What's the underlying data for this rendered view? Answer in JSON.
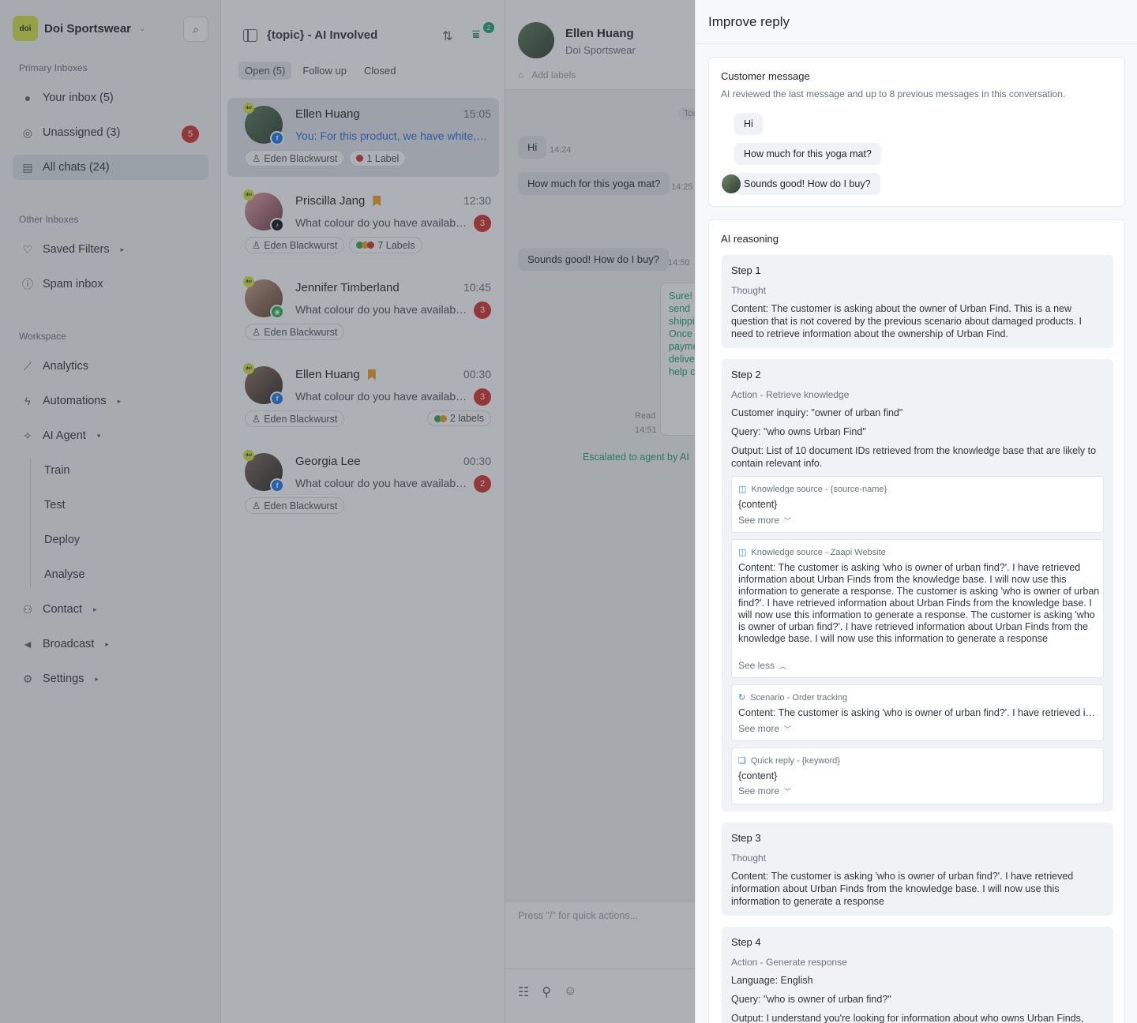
{
  "sidebar": {
    "brand_logo": "doi",
    "brand_name": "Doi Sportswear",
    "primary_label": "Primary Inboxes",
    "your_inbox": "Your inbox (5)",
    "unassigned": "Unassigned (3)",
    "unassigned_badge": "5",
    "all_chats": "All chats (24)",
    "other_label": "Other Inboxes",
    "saved_filters": "Saved Filters",
    "spam_inbox": "Spam inbox",
    "workspace_label": "Workspace",
    "analytics": "Analytics",
    "automations": "Automations",
    "ai_agent": "AI Agent",
    "ai_sub": [
      "Train",
      "Test",
      "Deploy",
      "Analyse"
    ],
    "contact": "Contact",
    "broadcast": "Broadcast",
    "settings": "Settings"
  },
  "conv_list": {
    "title": "{topic} - AI Involved",
    "filter_count": "2",
    "tabs": [
      "Open (5)",
      "Follow up",
      "Closed"
    ],
    "items": [
      {
        "name": "Ellen Huang",
        "time": "15:05",
        "preview": "You: For this product, we have white, black and grey",
        "agent": "Eden Blackwurst",
        "label": "1 Label",
        "channel": "f"
      },
      {
        "name": "Priscilla Jang",
        "time": "12:30",
        "preview": "What colour do you have available?",
        "badge": "3",
        "agent": "Eden Blackwurst",
        "label": "7 Labels",
        "channel": "♪"
      },
      {
        "name": "Jennifer Timberland",
        "time": "10:45",
        "preview": "What colour do you have available?",
        "badge": "3",
        "agent": "Eden Blackwurst",
        "channel": "◉"
      },
      {
        "name": "Ellen Huang",
        "time": "00:30",
        "preview": "What colour do you have available?",
        "badge": "3",
        "agent": "Eden Blackwurst",
        "label": "2 labels",
        "channel": "f"
      },
      {
        "name": "Georgia Lee",
        "time": "00:30",
        "preview": "What colour do you have available?",
        "badge": "2",
        "agent": "Eden Blackwurst",
        "channel": "f"
      }
    ]
  },
  "chat": {
    "name": "Ellen Huang",
    "sub": "Doi Sportswear",
    "add_labels": "Add labels",
    "today": "Tod",
    "messages": [
      {
        "text": "Hi",
        "time": "14:24"
      },
      {
        "text": "How much for this yoga mat?",
        "time": "14:25"
      },
      {
        "text": "Sounds good! How do I buy?",
        "time": "14:50"
      }
    ],
    "agent_reply": "Sure! send shippi Once payme delive help c",
    "read": "Read",
    "read_time": "14:51",
    "escalated": "Escalated to agent by AI",
    "composer_placeholder": "Press \"/\" for quick actions..."
  },
  "drawer": {
    "title": "Improve reply",
    "customer_message": {
      "title": "Customer message",
      "subtitle": "AI reviewed the last message and up to 8 previous messages in this conversation.",
      "messages": [
        "Hi",
        "How much for this yoga mat?",
        "Sounds good! How do I buy?"
      ]
    },
    "reasoning_title": "AI reasoning",
    "steps": [
      {
        "title": "Step 1",
        "kind": "Thought",
        "content": "Content: The customer is asking about the owner of Urban Find. This is a new question that is not covered by the previous scenario about damaged products. I need to retrieve information about the ownership of Urban Find."
      },
      {
        "title": "Step 2",
        "kind": "Action - Retrieve knowledge",
        "inquiry": "Customer inquiry: \"owner of urban find\"",
        "query": "Query: \"who owns Urban Find\"",
        "output": "Output: List of 10 document IDs retrieved from the knowledge base that are likely to contain relevant info.",
        "sources": [
          {
            "head": "Knowledge source - {source-name}",
            "body": "{content}",
            "toggle": "See more"
          },
          {
            "head": "Knowledge source - Zaapi Website",
            "body": "Content: The customer is asking 'who is owner of urban find?'. I have retrieved information about Urban Finds from the knowledge base. I will now use this information to generate a response. The customer is asking 'who is owner of urban find?'. I have retrieved information about Urban Finds from the knowledge base. I will now use this information to generate a response. The customer is asking 'who is owner of urban find?'. I have retrieved information about Urban Finds from the knowledge base. I will now use this information to generate a response",
            "toggle": "See less"
          },
          {
            "head": "Scenario - Order tracking",
            "body": "Content: The customer is asking 'who is owner of urban find?'. I have retrieved information about Urban Finds from the knowledge base.",
            "toggle": "See more"
          },
          {
            "head": "Quick reply - {keyword}",
            "body": "{content}",
            "toggle": "See more"
          }
        ]
      },
      {
        "title": "Step 3",
        "kind": "Thought",
        "content": "Content: The customer is asking 'who is owner of urban find?'. I have retrieved information about Urban Finds from the knowledge base. I will now use this information to generate a response"
      },
      {
        "title": "Step 4",
        "kind": "Action - Generate response",
        "language": "Language: English",
        "query": "Query: \"who is owner of urban find?\"",
        "output": "Output: I understand you're looking for information about who owns Urban Finds,"
      }
    ]
  }
}
